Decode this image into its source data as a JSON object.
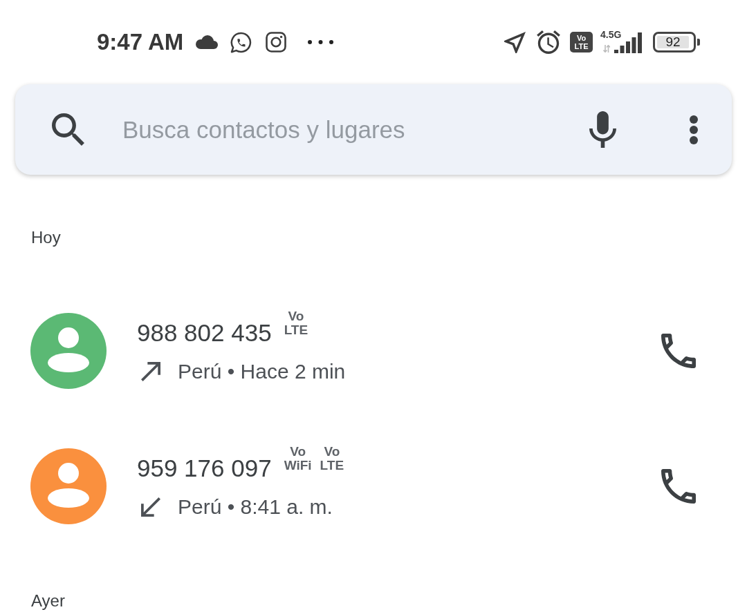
{
  "status_bar": {
    "time": "9:47 AM",
    "volte_badge": {
      "lines": [
        "Vo",
        "LTE"
      ]
    },
    "network": "4.5G",
    "battery": "92"
  },
  "search": {
    "placeholder": "Busca contactos y lugares"
  },
  "sections": [
    {
      "label": "Hoy",
      "calls": [
        {
          "number": "988 802 435",
          "badges": [
            {
              "lines": [
                "Vo",
                "LTE"
              ]
            }
          ],
          "kind": "outgoing",
          "details": "Perú • Hace 2 min",
          "color": "#5bb974"
        },
        {
          "number": "959 176 097",
          "badges": [
            {
              "lines": [
                "Vo",
                "WiFi"
              ]
            },
            {
              "lines": [
                "Vo",
                "LTE"
              ]
            }
          ],
          "kind": "incoming",
          "details": "Perú • 8:41 a. m.",
          "color": "#fa903e"
        }
      ]
    },
    {
      "label": "Ayer"
    }
  ]
}
